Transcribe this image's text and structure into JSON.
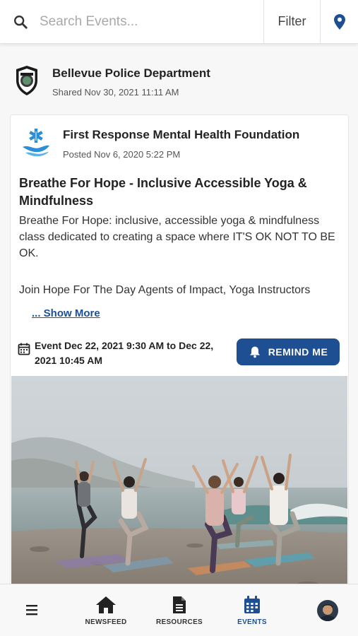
{
  "search": {
    "placeholder": "Search Events..."
  },
  "toolbar": {
    "filter_label": "Filter",
    "location_icon": "map-pin-icon"
  },
  "share": {
    "org": "Bellevue Police Department",
    "date": "Shared Nov 30, 2021 11:11 AM",
    "logo_icon": "police-badge-icon"
  },
  "post": {
    "org": "First Response Mental Health Foundation",
    "date": "Posted Nov 6, 2020 5:22 PM",
    "logo_icon": "star-of-life-icon",
    "title": "Breathe For Hope - Inclusive Accessible Yoga & Mindfulness",
    "description": "Breathe For Hope: inclusive, accessible yoga & mindfulness class dedicated to creating a space where IT'S OK NOT TO BE OK.",
    "description_2": "Join Hope For The Day Agents of Impact, Yoga Instructors",
    "show_more": "... Show More",
    "event_time": "Event Dec 22, 2021 9:30 AM to Dec 22, 2021 10:45 AM",
    "remind_label": "REMIND ME"
  },
  "nav": {
    "items": [
      {
        "label": "NEWSFEED",
        "icon": "home-icon"
      },
      {
        "label": "RESOURCES",
        "icon": "document-icon"
      },
      {
        "label": "EVENTS",
        "icon": "calendar-icon",
        "active": true
      }
    ],
    "menu_icon": "hamburger-menu-icon",
    "avatar": "user-avatar"
  },
  "colors": {
    "brand": "#1e4f93",
    "link": "#1c4f95",
    "mh_blue": "#2a8fd6"
  }
}
